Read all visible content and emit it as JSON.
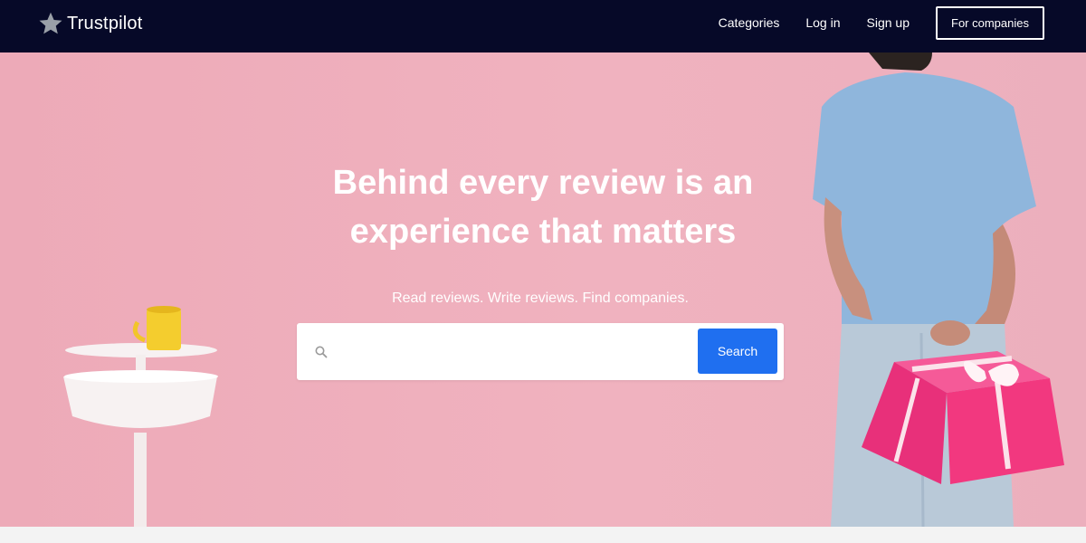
{
  "brand": {
    "name": "Trustpilot",
    "logo_icon": "star-icon"
  },
  "nav": {
    "categories": "Categories",
    "login": "Log in",
    "signup": "Sign up",
    "for_companies": "For companies"
  },
  "hero": {
    "title_line1": "Behind every review is an",
    "title_line2": "experience that matters",
    "subtitle": "Read reviews. Write reviews. Find companies.",
    "search_placeholder": "",
    "search_button": "Search",
    "search_icon": "search-icon"
  },
  "colors": {
    "nav_bg": "#060928",
    "hero_bg": "#f0b2bf",
    "search_button": "#1f6ff0",
    "gift": "#f0307a"
  }
}
